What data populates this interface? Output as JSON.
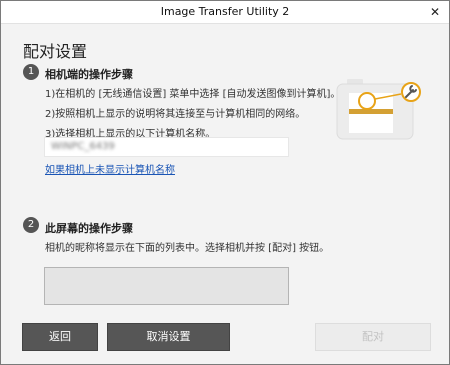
{
  "window": {
    "title": "Image Transfer Utility 2",
    "close_glyph": "✕"
  },
  "page": {
    "heading": "配对设置"
  },
  "step1": {
    "number": "1",
    "title": "相机端的操作步骤",
    "line1": "1)在相机的 [无线通信设置] 菜单中选择 [自动发送图像到计算机]。",
    "line2": "2)按照相机上显示的说明将其连接至与计算机相同的网络。",
    "line3": "3)选择相机上显示的以下计算机名称。",
    "computer_name": "WINPC_6439",
    "help_link": "如果相机上未显示计算机名称"
  },
  "step2": {
    "number": "2",
    "title": "此屏幕的操作步骤",
    "description": "相机的昵称将显示在下面的列表中。选择相机并按 [配对] 按钮。"
  },
  "buttons": {
    "back": "返回",
    "cancel": "取消设置",
    "pair": "配对"
  },
  "icons": {
    "close": "close-icon",
    "camera": "camera-illustration-icon",
    "wrench": "wrench-icon"
  },
  "colors": {
    "accent_gold": "#e8a317",
    "link_blue": "#1a55b5",
    "button_dark": "#565656",
    "button_disabled": "#ececec"
  }
}
